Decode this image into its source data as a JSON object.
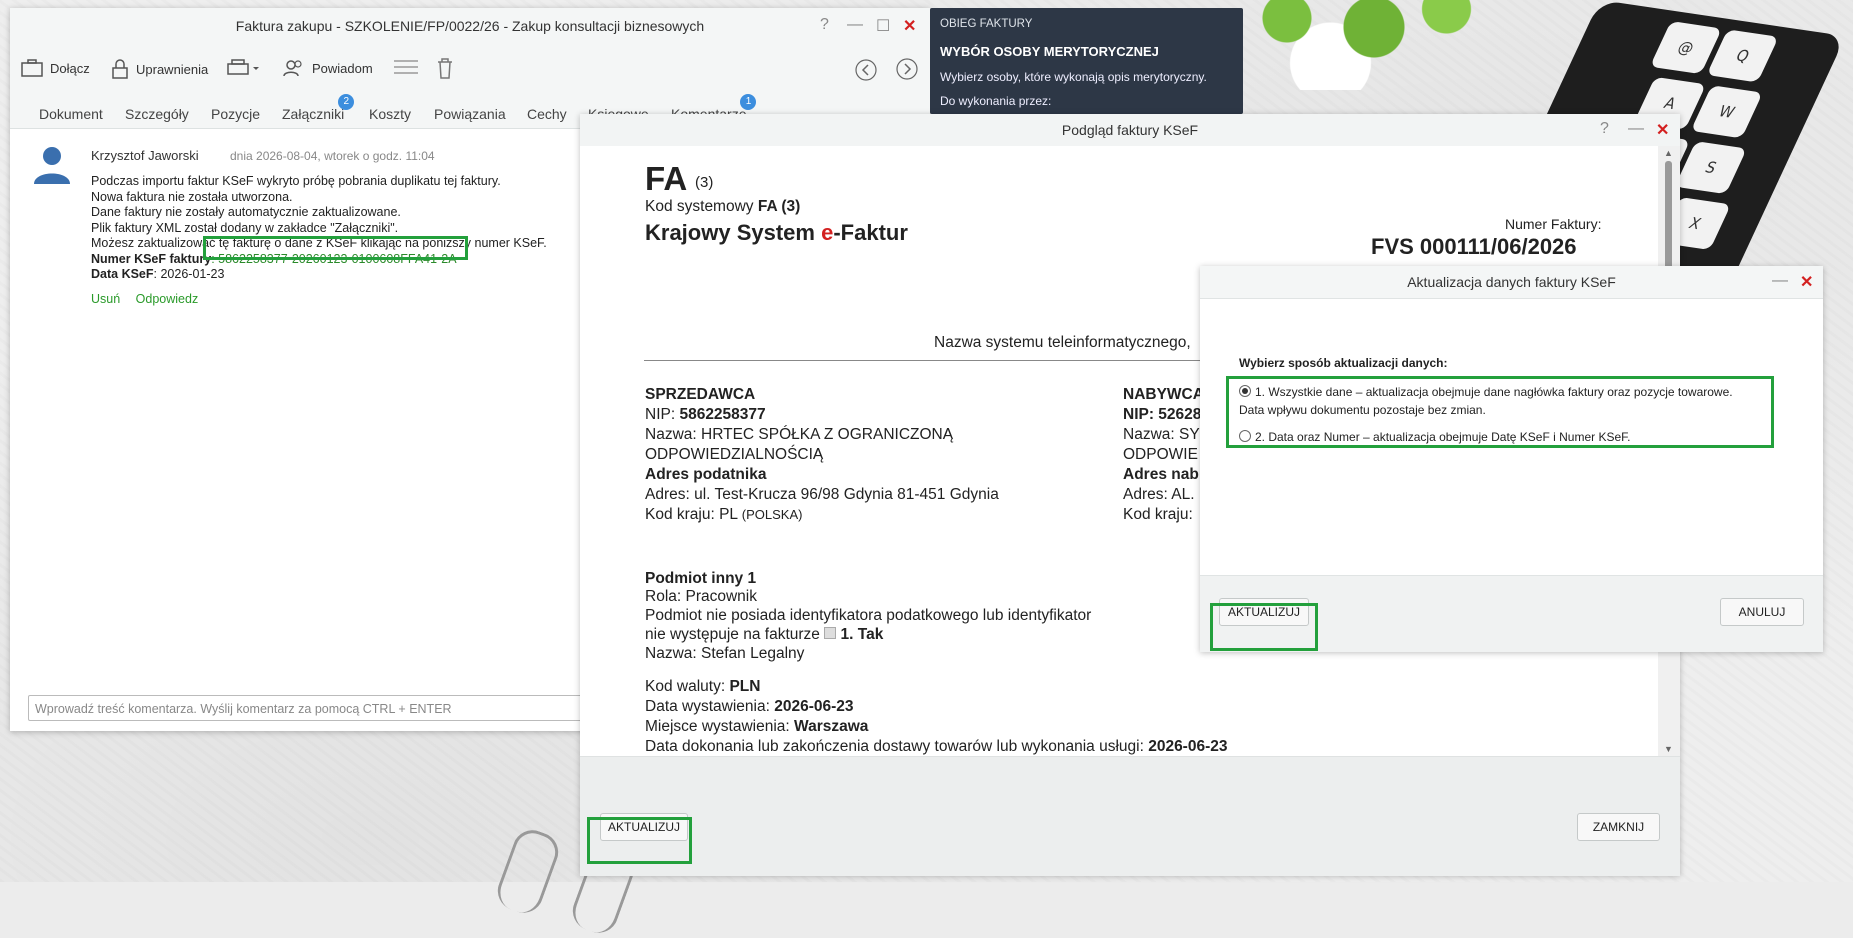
{
  "main_window": {
    "title": "Faktura zakupu - SZKOLENIE/FP/0022/26 - Zakup konsultacji biznesowych",
    "toolbar": {
      "attach": "Dołącz",
      "permissions": "Uprawnienia",
      "remind": "Powiadom"
    },
    "tabs": [
      {
        "label": "Dokument"
      },
      {
        "label": "Szczegóły"
      },
      {
        "label": "Pozycje"
      },
      {
        "label": "Załączniki",
        "badge": "2"
      },
      {
        "label": "Koszty"
      },
      {
        "label": "Powiązania"
      },
      {
        "label": "Cechy"
      },
      {
        "label": "Księgowe"
      },
      {
        "label": "Komentarze",
        "badge": "1"
      }
    ],
    "comment": {
      "author": "Krzysztof Jaworski",
      "date": "dnia 2026-08-04, wtorek o godz. 11:04",
      "lines": [
        "Podczas importu faktur KSeF wykryto próbę pobrania duplikatu tej faktury.",
        "Nowa faktura nie została utworzona.",
        "Dane faktury nie zostały automatycznie zaktualizowane.",
        "Plik faktury XML został dodany w zakładce \"Załączniki\".",
        "Możesz zaktualizować tę fakturę o dane z KSeF klikając na poniższy numer KSeF."
      ],
      "ksef_label": "Numer KSeF faktury",
      "ksef_number": ": 5862258377-20260123-0100608FFA41-2A",
      "ksef_date_label": "Data KSeF",
      "ksef_date": ": 2026-01-23",
      "delete": "Usuń",
      "reply": "Odpowiedz"
    },
    "comment_placeholder": "Wprowadź treść komentarza. Wyślij komentarz za pomocą CTRL + ENTER"
  },
  "obieg": {
    "header": "OBIEG FAKTURY",
    "title": "WYBÓR OSOBY MERYTORYCZNEJ",
    "text": "Wybierz osoby, które wykonają opis merytoryczny.",
    "text2": "Do wykonania przez:"
  },
  "preview": {
    "title": "Podgląd faktury KSeF",
    "fa": "FA",
    "fa_ver": "(3)",
    "system_code_label": "Kod systemowy ",
    "system_code": "FA (3)",
    "ksef_pre": "Krajowy System ",
    "ksef_e": "e",
    "ksef_post": "-Faktur",
    "invoice_no_label": "Numer Faktury:",
    "invoice_no": "FVS 000111/06/2026",
    "system_name": "Nazwa systemu teleinformatycznego,",
    "seller_header": "SPRZEDAWCA",
    "seller_nip_label": "NIP: ",
    "seller_nip": "5862258377",
    "seller_name_label": "Nazwa: ",
    "seller_name1": "HRTEC SPÓŁKA Z OGRANICZONĄ",
    "seller_name2": "ODPOWIEDZIALNOŚCIĄ",
    "seller_addr_header": "Adres podatnika",
    "seller_addr": "Adres: ul. Test-Krucza 96/98 Gdynia 81-451 Gdynia",
    "seller_country": "Kod kraju: PL",
    "seller_country_name": "(POLSKA)",
    "buyer_header": "NABYWCA",
    "buyer_nip": "NIP: 52628",
    "buyer_name": "Nazwa: SY",
    "buyer_name2": "ODPOWIE",
    "buyer_addr_header": "Adres nab",
    "buyer_addr": "Adres: AL.",
    "buyer_country": "Kod kraju:",
    "other_header": "Podmiot inny 1",
    "role": "Rola: Pracownik",
    "no_id1": "Podmiot nie posiada identyfikatora podatkowego lub identyfikator",
    "no_id2": "nie występuje na fakturze",
    "no_id_val": "1. Tak",
    "other_name": "Nazwa: Stefan Legalny",
    "currency_label": "Kod waluty: ",
    "currency": "PLN",
    "issue_date_label": "Data wystawienia: ",
    "issue_date": "2026-06-23",
    "place_label": "Miejsce wystawienia: ",
    "place": "Warszawa",
    "delivery_label": "Data dokonania lub zakończenia dostawy towarów lub wykonania usługi: ",
    "delivery": "2026-06-23",
    "btn_update": "AKTUALIZUJ",
    "btn_close": "ZAMKNIJ"
  },
  "update_dialog": {
    "title": "Aktualizacja danych faktury KSeF",
    "prompt": "Wybierz sposób aktualizacji danych:",
    "option1_line1": "1. Wszystkie dane – aktualizacja obejmuje dane nagłówka faktury oraz pozycje towarowe.",
    "option1_line2": "Data wpływu dokumentu pozostaje bez zmian.",
    "option2": "2. Data oraz Numer – aktualizacja obejmuje Datę KSeF i Numer KSeF.",
    "btn_update": "AKTUALIZUJ",
    "btn_cancel": "ANULUJ"
  },
  "colors": {
    "highlight": "#23a03c",
    "badge": "#3c8ede",
    "close": "#d32020",
    "obieg_bg": "#2d3746"
  }
}
